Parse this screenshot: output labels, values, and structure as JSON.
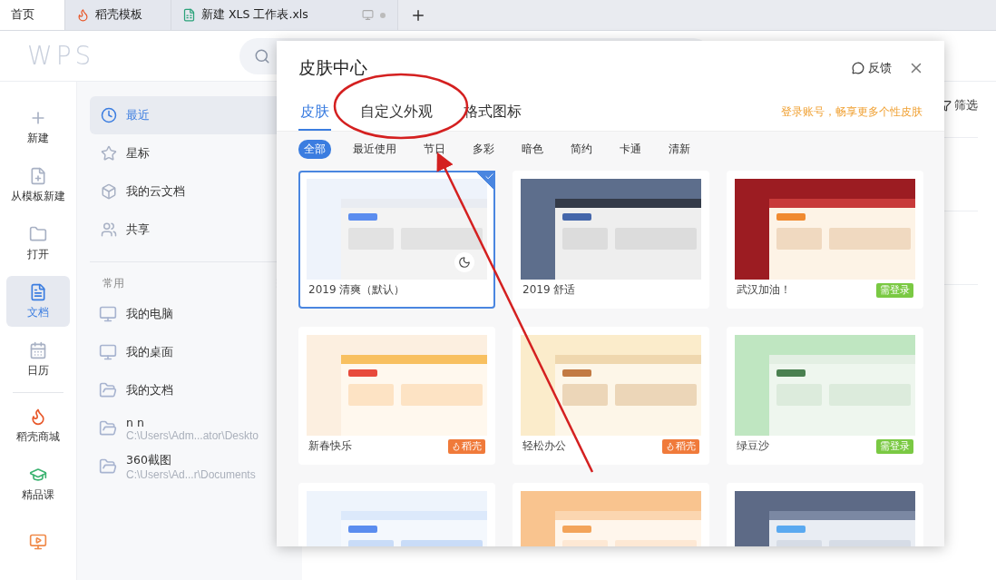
{
  "tabs": [
    {
      "label": "首页",
      "selected": true,
      "kind": "home"
    },
    {
      "label": "稻壳模板",
      "selected": false,
      "kind": "docer"
    },
    {
      "label": "新建 XLS 工作表.xls",
      "selected": false,
      "kind": "sheet"
    }
  ],
  "logo": "WPS",
  "rail": [
    {
      "label": "新建",
      "selected": false,
      "kind": "new"
    },
    {
      "label": "从模板新建",
      "selected": false,
      "kind": "template"
    },
    {
      "label": "打开",
      "selected": false,
      "kind": "open"
    },
    {
      "label": "文档",
      "selected": true,
      "kind": "docs"
    },
    {
      "label": "日历",
      "selected": false,
      "kind": "calendar"
    },
    {
      "label": "稻壳商城",
      "selected": false,
      "kind": "store"
    },
    {
      "label": "精品课",
      "selected": false,
      "kind": "course"
    },
    {
      "selected": false,
      "kind": "meeting"
    }
  ],
  "nav": {
    "items": [
      {
        "label": "最近",
        "selected": true,
        "kind": "recent"
      },
      {
        "label": "星标",
        "selected": false,
        "kind": "star"
      },
      {
        "label": "我的云文档",
        "selected": false,
        "kind": "cloud"
      },
      {
        "label": "共享",
        "selected": false,
        "kind": "share"
      }
    ],
    "section": "常用",
    "places": [
      {
        "label": "我的电脑",
        "kind": "computer"
      },
      {
        "label": "我的桌面",
        "kind": "desktop"
      },
      {
        "label": "我的文档",
        "kind": "folder"
      },
      {
        "label": "n n",
        "path": "C:\\Users\\Adm...ator\\Deskto",
        "kind": "folder"
      },
      {
        "label": "360截图",
        "path": "C:\\Users\\Ad...r\\Documents",
        "kind": "folder"
      }
    ]
  },
  "filter_button": "筛选",
  "dialog": {
    "title": "皮肤中心",
    "feedback": "反馈",
    "tabs": [
      {
        "label": "皮肤",
        "selected": true
      },
      {
        "label": "自定义外观",
        "selected": false
      },
      {
        "label": "格式图标",
        "selected": false
      }
    ],
    "login_hint": "登录账号，畅享更多个性皮肤",
    "categories": [
      {
        "label": "全部",
        "selected": true
      },
      {
        "label": "最近使用",
        "selected": false
      },
      {
        "label": "节日",
        "selected": false
      },
      {
        "label": "多彩",
        "selected": false
      },
      {
        "label": "暗色",
        "selected": false
      },
      {
        "label": "简约",
        "selected": false
      },
      {
        "label": "卡通",
        "selected": false
      },
      {
        "label": "清新",
        "selected": false
      }
    ],
    "skins": [
      {
        "name": "2019 清爽（默认）",
        "selected": true,
        "night_toggle": true
      },
      {
        "name": "2019 舒适",
        "selected": false,
        "night_toggle": false
      },
      {
        "name": "武汉加油！",
        "selected": false,
        "night_toggle": false,
        "badge": {
          "kind": "login",
          "text": "需登录"
        }
      },
      {
        "name": "新春快乐",
        "selected": false,
        "night_toggle": false,
        "badge": {
          "kind": "docer",
          "text": "稻壳"
        }
      },
      {
        "name": "轻松办公",
        "selected": false,
        "night_toggle": false,
        "badge": {
          "kind": "docer",
          "text": "稻壳"
        }
      },
      {
        "name": "绿豆沙",
        "selected": false,
        "night_toggle": false,
        "badge": {
          "kind": "login",
          "text": "需登录"
        }
      },
      {
        "selected": false,
        "night_toggle": false
      },
      {
        "selected": false,
        "night_toggle": false
      },
      {
        "selected": false,
        "night_toggle": false
      }
    ]
  }
}
